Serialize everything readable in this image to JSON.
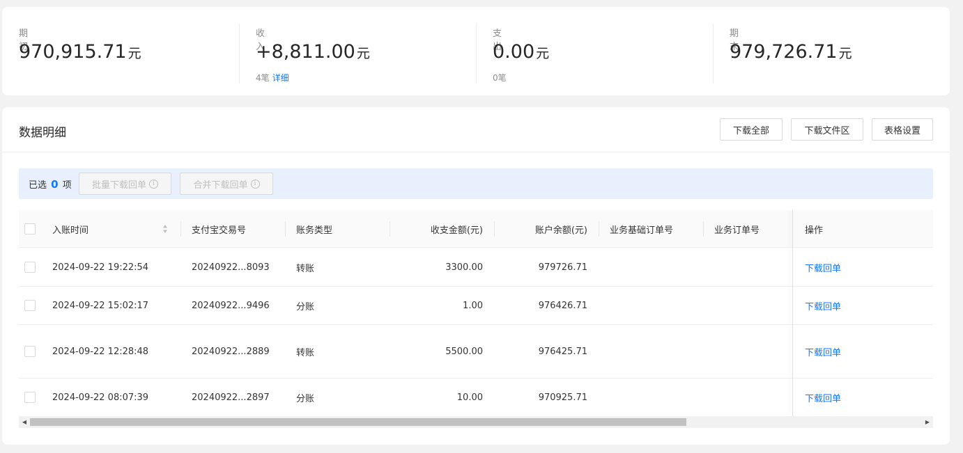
{
  "summary": {
    "opening": {
      "label": "期初",
      "value": "970,915.71",
      "unit": "元"
    },
    "income": {
      "label": "收入",
      "value": "+8,811.00",
      "unit": "元",
      "count": "4笔",
      "detail_link": "详细"
    },
    "expense": {
      "label": "支出",
      "value": "0.00",
      "unit": "元",
      "count": "0笔"
    },
    "closing": {
      "label": "期末",
      "value": "979,726.71",
      "unit": "元"
    }
  },
  "detail": {
    "title": "数据明细",
    "buttons": {
      "download_all": "下载全部",
      "download_area": "下载文件区",
      "table_settings": "表格设置"
    }
  },
  "selection": {
    "prefix": "已选",
    "count": "0",
    "suffix": "项",
    "batch_download": "批量下载回单",
    "merge_download": "合并下载回单"
  },
  "table": {
    "columns": {
      "time": "入账时间",
      "trade_no": "支付宝交易号",
      "type": "账务类型",
      "amount": "收支金额(元)",
      "balance": "账户余额(元)",
      "base_order": "业务基础订单号",
      "order": "业务订单号",
      "action": "操作"
    },
    "rows": [
      {
        "time": "2024-09-22 19:22:54",
        "trade_no": "20240922...8093",
        "type": "转账",
        "amount": "3300.00",
        "balance": "979726.71",
        "base_order": "",
        "order": "",
        "action": "下载回单"
      },
      {
        "time": "2024-09-22 15:02:17",
        "trade_no": "20240922...9496",
        "type": "分账",
        "amount": "1.00",
        "balance": "976426.71",
        "base_order": "",
        "order": "",
        "action": "下载回单"
      },
      {
        "time": "2024-09-22 12:28:48",
        "trade_no": "20240922...2889",
        "type": "转账",
        "amount": "5500.00",
        "balance": "976425.71",
        "base_order": "",
        "order": "",
        "action": "下载回单"
      },
      {
        "time": "2024-09-22 08:07:39",
        "trade_no": "20240922...2897",
        "type": "分账",
        "amount": "10.00",
        "balance": "970925.71",
        "base_order": "",
        "order": "",
        "action": "下载回单"
      }
    ]
  },
  "icons": {
    "info": "info-circle-icon",
    "sort": "sort-icon",
    "scroll_left": "scroll-left-arrow-icon",
    "scroll_right": "scroll-right-arrow-icon"
  },
  "colors": {
    "accent": "#1677ff",
    "selection_bg": "#e9f0fd",
    "page_bg": "#f2f2f2"
  }
}
